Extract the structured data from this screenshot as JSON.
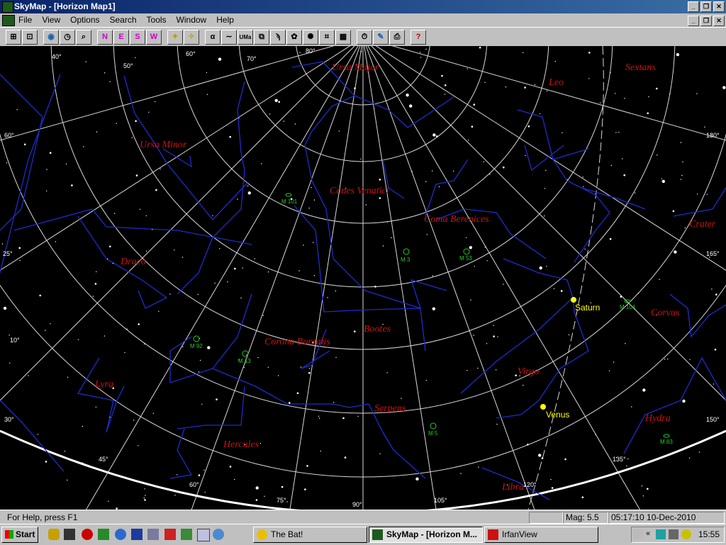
{
  "window": {
    "title": "SkyMap - [Horizon Map1]"
  },
  "menu": [
    "File",
    "View",
    "Options",
    "Search",
    "Tools",
    "Window",
    "Help"
  ],
  "toolbar": {
    "dir_n": "N",
    "dir_e": "E",
    "dir_s": "S",
    "dir_w": "W",
    "alpha": "α",
    "umi": "UMa"
  },
  "map": {
    "constellations": [
      "Ursa Major",
      "Sextans",
      "Leo",
      "Ursa Minor",
      "Canes Venatici",
      "Coma Berenices",
      "Crater",
      "Draco",
      "Corvus",
      "Bootes",
      "Corona Borealis",
      "Virgo",
      "Lyra",
      "Serpens",
      "Hydra",
      "Hercules",
      "Libra"
    ],
    "objects": [
      "M 101",
      "M 3",
      "M 53",
      "M 104",
      "M 92",
      "M 13",
      "M 5",
      "M 83"
    ],
    "planets": [
      "Saturn",
      "Venus"
    ],
    "grid_labels": [
      "40°",
      "50°",
      "60°",
      "70°",
      "80°",
      "60°",
      "180°",
      "165°",
      "25°",
      "10°",
      "30°",
      "150°",
      "45°",
      "135°",
      "60°",
      "75°",
      "90°",
      "105°",
      "120°"
    ],
    "colors": {
      "background": "#000000",
      "constellation_lines": "#1d2ccc",
      "names": "#cc1111",
      "grid": "#d8d8d8",
      "deep_sky": "#22cc22",
      "planet": "#ffff00"
    }
  },
  "status": {
    "help": "For Help, press F1",
    "mag": "Mag: 5.5",
    "datetime": "05:17:10 10-Dec-2010"
  },
  "taskbar": {
    "start": "Start",
    "tasks": [
      "The Bat!",
      "SkyMap - [Horizon M...",
      "IrfanView"
    ],
    "clock": "15:55",
    "tray_arrow": "«"
  }
}
